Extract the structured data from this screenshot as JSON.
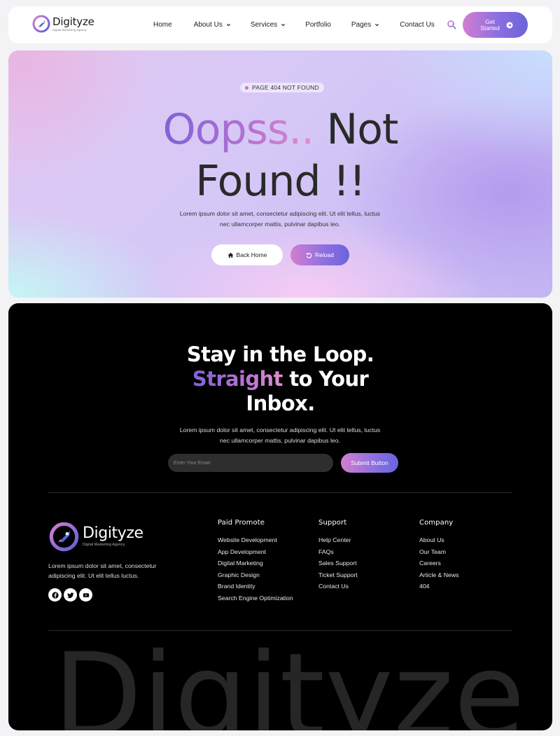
{
  "header": {
    "logo": {
      "name": "Digityze",
      "tagline": "Digital Marketing Agency"
    },
    "nav": [
      {
        "label": "Home",
        "dropdown": false
      },
      {
        "label": "About Us",
        "dropdown": true
      },
      {
        "label": "Services",
        "dropdown": true
      },
      {
        "label": "Portfolio",
        "dropdown": false
      },
      {
        "label": "Pages",
        "dropdown": true
      },
      {
        "label": "Contact Us",
        "dropdown": false
      }
    ],
    "search_icon": "search-icon",
    "cta_label": "Get Started"
  },
  "hero": {
    "badge": "PAGE 404 NOT FOUND",
    "title_gradient": "Oopss..",
    "title_rest_1": "Not",
    "title_rest_2": "Found !!",
    "description": "Lorem ipsum dolor sit amet, consectetur adipiscing elit. Ut elit tellus, luctus nec ullamcorper mattis, pulvinar dapibus leo.",
    "back_home_label": "Back Home",
    "reload_label": "Reload"
  },
  "newsletter": {
    "title_line1": "Stay in the Loop.",
    "title_gradient": "Straight",
    "title_line2_rest": "to Your",
    "title_line3": "Inbox.",
    "description": "Lorem ipsum dolor sit amet, consectetur adipiscing elit. Ut elit tellus, luctus nec ullamcorper mattis, pulvinar dapibus leo.",
    "email_placeholder": "Enter Your Email",
    "submit_label": "Submit Button"
  },
  "footer": {
    "logo": {
      "name": "Digityze",
      "tagline": "Digital Marketing Agency"
    },
    "about": "Lorem ipsum dolor sit amet, consectetur adipiscing elit. Ut elit tellus luctus.",
    "socials": [
      "facebook-icon",
      "twitter-icon",
      "youtube-icon"
    ],
    "columns": [
      {
        "title": "Paid Promote",
        "links": [
          "Website Development",
          "App Development",
          "Digital Marketing",
          "Graphic Design",
          "Brand Identity",
          "Search Engine Optimization"
        ]
      },
      {
        "title": "Support",
        "links": [
          "Help Center",
          "FAQs",
          "Sales Support",
          "Ticket Support",
          "Contact Us"
        ]
      },
      {
        "title": "Company",
        "links": [
          "About Us",
          "Our Team",
          "Careers",
          "Article & News",
          "404"
        ]
      }
    ],
    "wordmark": "Digityze"
  },
  "colors": {
    "accent_pink": "#d37ed0",
    "accent_purple": "#6c63db",
    "footer_bg": "#000000"
  }
}
